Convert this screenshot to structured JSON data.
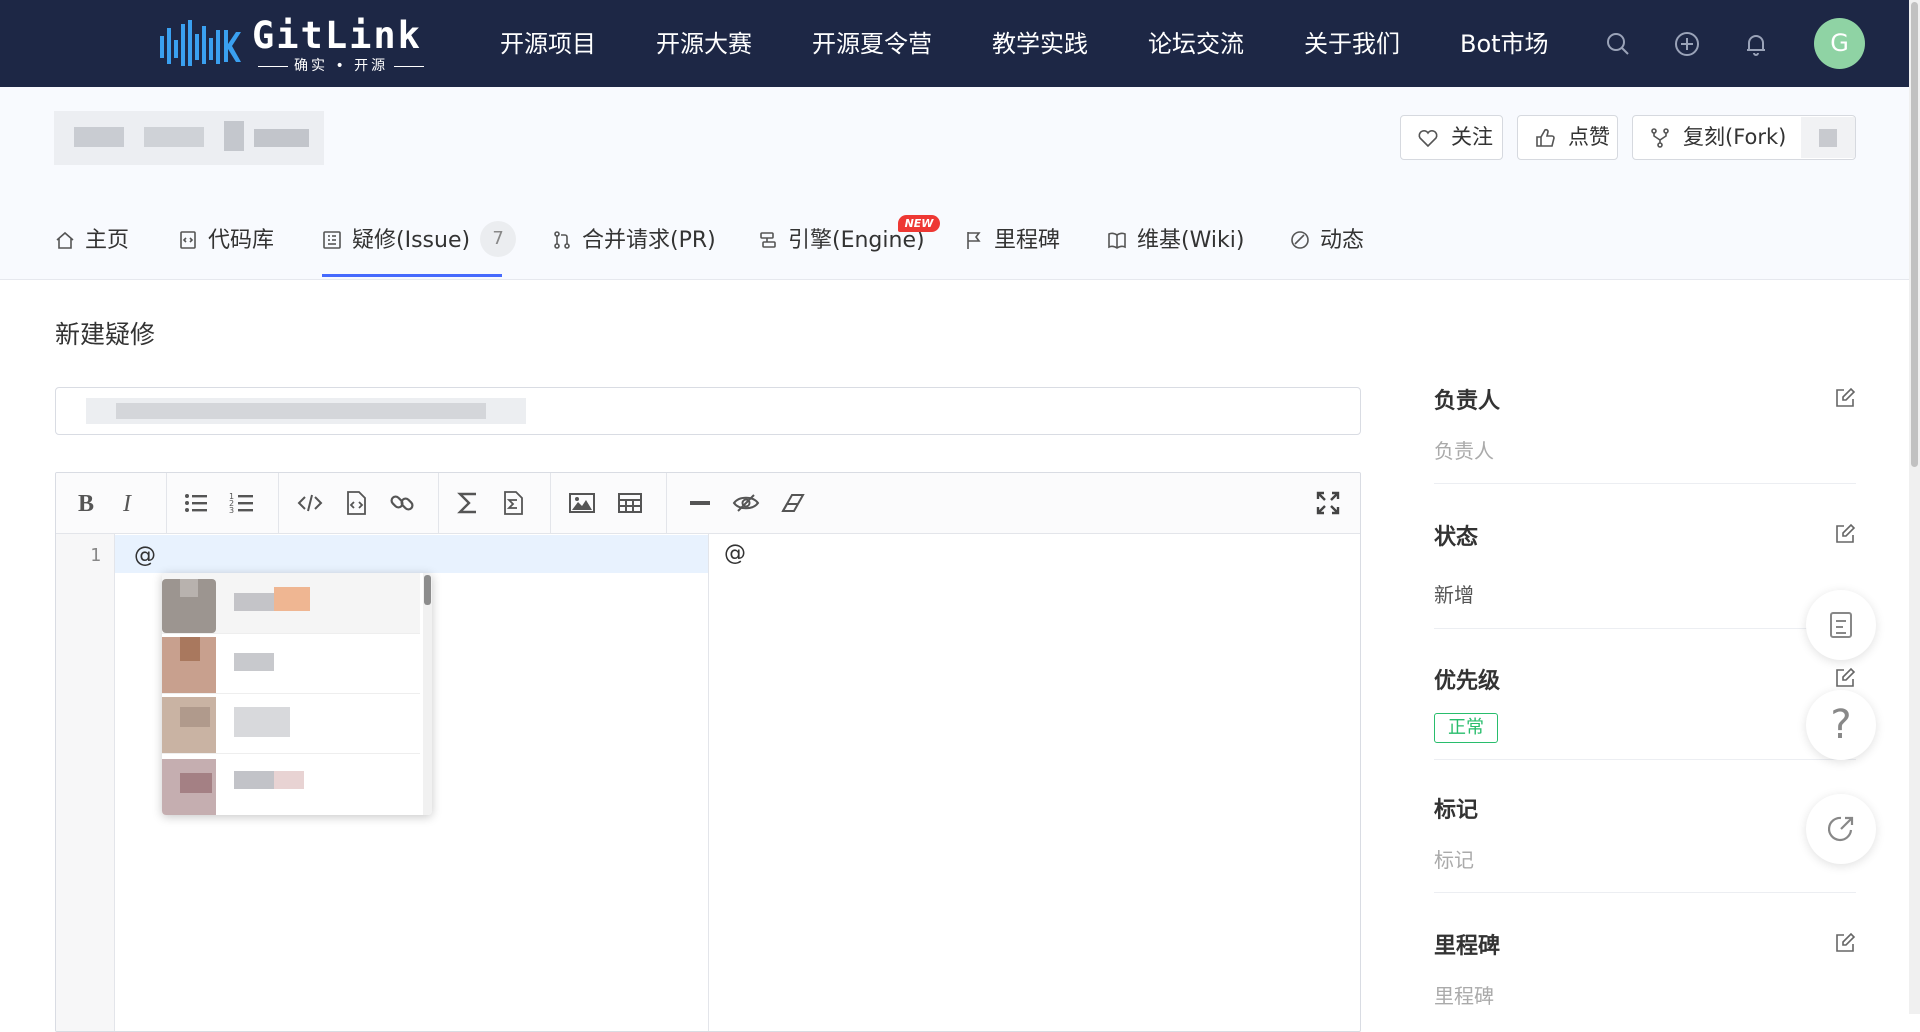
{
  "topnav": {
    "logo_word": "GitLink",
    "logo_sub": "确实 • 开源",
    "items": [
      "开源项目",
      "开源大赛",
      "开源夏令营",
      "教学实践",
      "论坛交流",
      "关于我们",
      "Bot市场"
    ],
    "icons": [
      "search-icon",
      "add-circle-icon",
      "bell-icon"
    ],
    "avatar_letter": "G",
    "colors": {
      "bg": "#1d2745",
      "logo_accent": "#3aa0f0",
      "avatar": "#8fd3a4"
    }
  },
  "repo": {
    "buttons": {
      "watch": "关注",
      "star": "点赞",
      "fork": "复刻(Fork)"
    },
    "tabs": [
      {
        "label": "主页",
        "icon": "home-icon"
      },
      {
        "label": "代码库",
        "icon": "code-file-icon"
      },
      {
        "label": "疑修(Issue)",
        "icon": "issue-list-icon",
        "count": "7"
      },
      {
        "label": "合并请求(PR)",
        "icon": "pull-request-icon"
      },
      {
        "label": "引擎(Engine)",
        "icon": "engine-icon",
        "badge": "NEW"
      },
      {
        "label": "里程碑",
        "icon": "flag-icon"
      },
      {
        "label": "维基(Wiki)",
        "icon": "book-icon"
      },
      {
        "label": "动态",
        "icon": "activity-icon"
      }
    ],
    "active_tab": "疑修(Issue)",
    "accent": "#466afd"
  },
  "main": {
    "title": "新建疑修",
    "editor": {
      "toolbar_icons": [
        "bold-icon",
        "italic-icon",
        "bullet-list-icon",
        "numbered-list-icon",
        "code-icon",
        "code-block-icon",
        "link-icon",
        "formula-icon",
        "formula-block-icon",
        "image-icon",
        "table-icon",
        "horizontal-rule-icon",
        "preview-toggle-icon",
        "eraser-icon",
        "fullscreen-icon"
      ],
      "line_number": "1",
      "content": "@",
      "preview": "@"
    }
  },
  "sidebar": {
    "assignee": {
      "title": "负责人",
      "value": "负责人"
    },
    "status": {
      "title": "状态",
      "value": "新增"
    },
    "priority": {
      "title": "优先级",
      "value": "正常"
    },
    "label": {
      "title": "标记",
      "value": "标记"
    },
    "milestone": {
      "title": "里程碑",
      "value": "里程碑"
    }
  },
  "floating": {
    "icons": [
      "notes-icon",
      "help-icon",
      "share-icon"
    ],
    "help_glyph": "?"
  }
}
